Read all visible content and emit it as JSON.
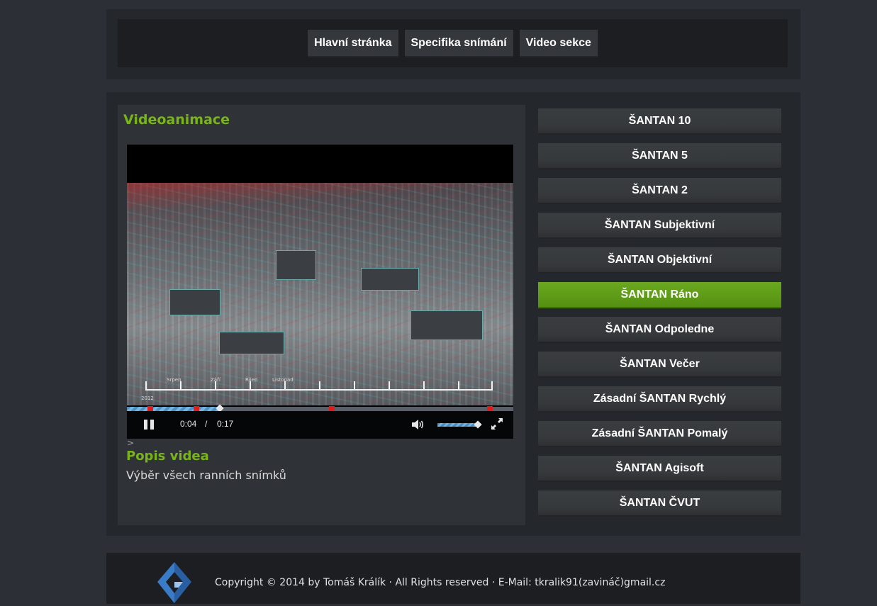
{
  "nav": {
    "items": [
      {
        "label": "Hlavní stránka"
      },
      {
        "label": "Specifika snímání"
      },
      {
        "label": "Video sekce"
      }
    ]
  },
  "main": {
    "title": "Videoanimace",
    "video": {
      "current_time": "0:04",
      "separator": "/",
      "duration": "0:17",
      "progress_fraction": 0.24,
      "volume_fraction": 0.95,
      "cue_fractions": [
        0.06,
        0.18,
        0.53,
        0.94
      ],
      "timeline_labels": [
        "Srpen",
        "Září",
        "Říjen",
        "Listopad",
        "2012"
      ],
      "icons": {
        "play_pause": "pause-icon",
        "volume": "volume-icon",
        "fullscreen": "fullscreen-icon"
      }
    },
    "chevron": ">",
    "description_title": "Popis videa",
    "description_text": "Výběr všech ranních snímků"
  },
  "sidebar": {
    "items": [
      {
        "label": "ŠANTAN 10",
        "active": false
      },
      {
        "label": "ŠANTAN 5",
        "active": false
      },
      {
        "label": "ŠANTAN 2",
        "active": false
      },
      {
        "label": "ŠANTAN Subjektivní",
        "active": false
      },
      {
        "label": "ŠANTAN Objektivní",
        "active": false
      },
      {
        "label": "ŠANTAN Ráno",
        "active": true
      },
      {
        "label": "ŠANTAN Odpoledne",
        "active": false
      },
      {
        "label": "ŠANTAN Večer",
        "active": false
      },
      {
        "label": "Zásadní ŠANTAN Rychlý",
        "active": false
      },
      {
        "label": "Zásadní ŠANTAN Pomalý",
        "active": false
      },
      {
        "label": "ŠANTAN Agisoft",
        "active": false
      },
      {
        "label": "ŠANTAN ČVUT",
        "active": false
      }
    ]
  },
  "footer": {
    "text": "Copyright © 2014 by Tomáš Králík  ·  All Rights reserved  ·  E-Mail: tkralik91(zavináč)gmail.cz",
    "logo": "gk-logo"
  },
  "colors": {
    "accent_green": "#7ab41b",
    "active_button": "#6aa820",
    "background": "#2c2f35"
  }
}
